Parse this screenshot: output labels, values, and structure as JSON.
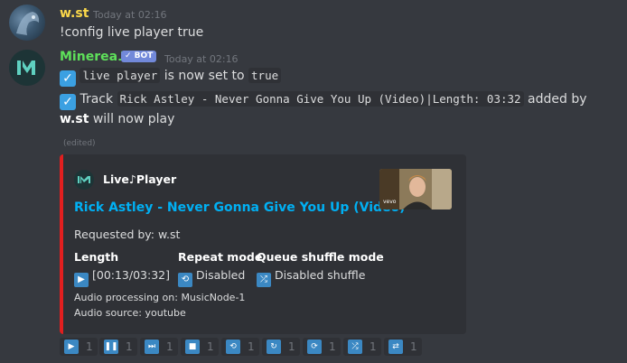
{
  "message1": {
    "username": "w.st",
    "timestamp": "Today at 02:16",
    "text": "!config live player true"
  },
  "message2": {
    "username": "Minerea♪",
    "bot_badge": "✓ BOT",
    "timestamp": "Today at 02:16",
    "line1": {
      "code1": "live player",
      "middle": "is now set to",
      "code2": "true"
    },
    "line2": {
      "prefix": "Track",
      "code": "Rick Astley - Never Gonna Give You Up (Video)|Length: 03:32",
      "suffix": "added by"
    },
    "line3": {
      "user": "w.st",
      "text": "will now play"
    },
    "edited": "(edited)"
  },
  "embed": {
    "author": "Live♪Player",
    "title": "Rick Astley - Never Gonna Give You Up (Video)",
    "requested_by": "Requested by: w.st",
    "fields": [
      {
        "name": "Length",
        "value": "[00:13/03:32]",
        "icon": "play-icon"
      },
      {
        "name": "Repeat mode",
        "value": "Disabled",
        "icon": "repeat-icon"
      },
      {
        "name": "Queue shuffle mode",
        "value": "Disabled shuffle",
        "icon": "shuffle-icon"
      }
    ],
    "footer1": "Audio processing on: MusicNode-1",
    "footer2": "Audio source: youtube",
    "thumbnail_label": "vevo",
    "accent_color": "#e11f1f"
  },
  "reactions": [
    {
      "icon": "play-icon",
      "count": "1"
    },
    {
      "icon": "pause-icon",
      "count": "1"
    },
    {
      "icon": "skip-forward-icon",
      "count": "1"
    },
    {
      "icon": "stop-icon",
      "count": "1"
    },
    {
      "icon": "repeat-icon",
      "count": "1"
    },
    {
      "icon": "repeat-one-icon",
      "count": "1"
    },
    {
      "icon": "repeat-all-icon",
      "count": "1"
    },
    {
      "icon": "shuffle-icon",
      "count": "1"
    },
    {
      "icon": "shuffle-queue-icon",
      "count": "1"
    }
  ],
  "colors": {
    "background": "#36393f",
    "username1": "#fbd84a",
    "username2": "#5ee05a",
    "link": "#00b0f4",
    "emoji_blue": "#3b88c3"
  }
}
